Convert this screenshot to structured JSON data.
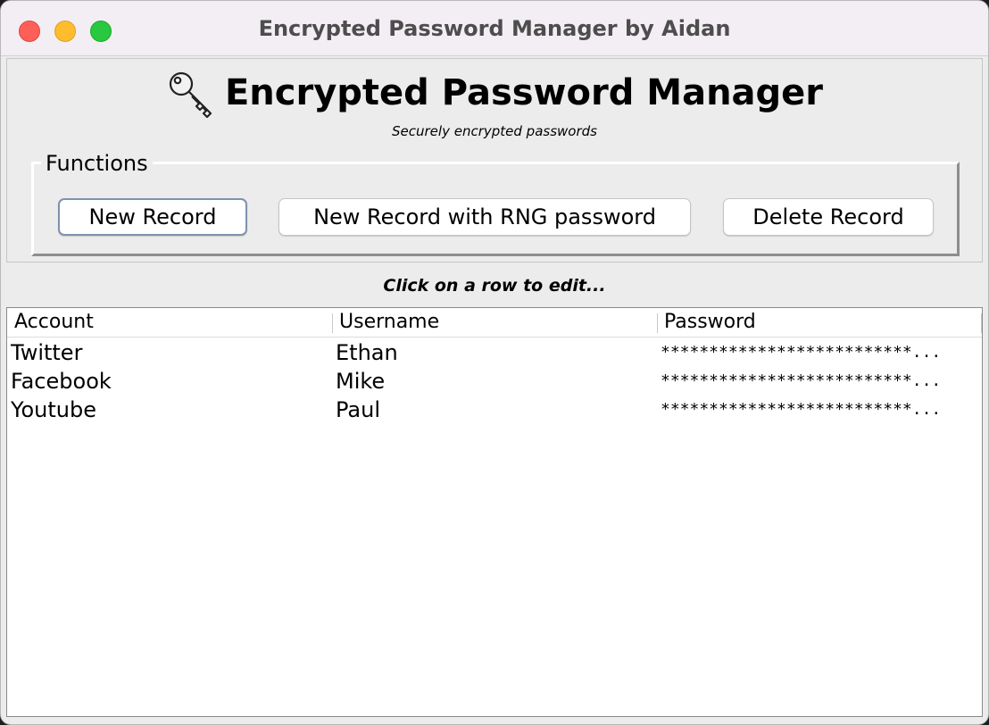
{
  "window": {
    "title": "Encrypted Password Manager by Aidan"
  },
  "header": {
    "title": "Encrypted Password Manager",
    "subtitle": "Securely encrypted passwords",
    "icon": "key-icon"
  },
  "functions": {
    "legend": "Functions",
    "new_record_label": "New Record",
    "new_rng_record_label": "New Record with RNG password",
    "delete_record_label": "Delete Record"
  },
  "hint": "Click on a row to edit...",
  "table": {
    "columns": [
      "Account",
      "Username",
      "Password"
    ],
    "rows": [
      {
        "account": "Twitter",
        "username": "Ethan",
        "password": "**************************..."
      },
      {
        "account": "Facebook",
        "username": "Mike",
        "password": "**************************..."
      },
      {
        "account": "Youtube",
        "username": "Paul",
        "password": "**************************..."
      }
    ]
  },
  "colors": {
    "close": "#fe5f57",
    "minimize": "#febc2e",
    "zoom": "#28c840",
    "default_button_border": "#7d93ad"
  }
}
